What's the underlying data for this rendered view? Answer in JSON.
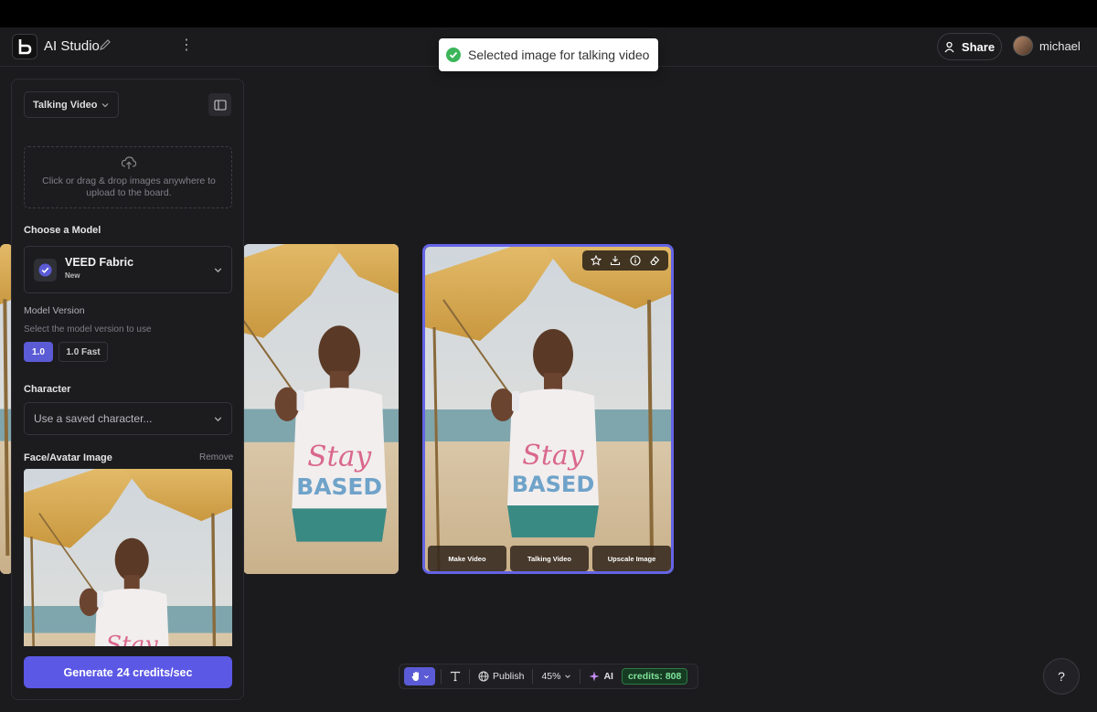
{
  "header": {
    "app_title": "AI Studio",
    "share_label": "Share",
    "username": "michael"
  },
  "toast": {
    "message": "Selected image for talking video",
    "status_color": "#3cb55a"
  },
  "panel": {
    "mode": "Talking Video",
    "upload_hint": "Click or drag & drop images anywhere to upload to the board.",
    "choose_model_label": "Choose a Model",
    "model_name": "VEED Fabric",
    "model_badge": "New",
    "model_version_label": "Model Version",
    "model_version_hint": "Select the model version to use",
    "versions": [
      "1.0",
      "1.0 Fast"
    ],
    "selected_version": "1.0",
    "character_label": "Character",
    "character_placeholder": "Use a saved character...",
    "face_label": "Face/Avatar Image",
    "remove_label": "Remove",
    "generate_prefix": "Generate",
    "generate_credits": "24 credits/sec"
  },
  "selected_card": {
    "actions": [
      "Make Video",
      "Talking Video",
      "Upscale Image"
    ],
    "tool_icons": [
      "star-icon",
      "download-icon",
      "info-icon",
      "eraser-icon"
    ]
  },
  "toolbar": {
    "publish_label": "Publish",
    "zoom": "45%",
    "ai_label": "AI",
    "credits": "credits: 808"
  },
  "help": {
    "label": "?"
  },
  "colors": {
    "accent": "#5b5bd6",
    "selection_border": "#6464e6",
    "credits_green": "#7fe39a",
    "background": "#1b1b1d"
  }
}
